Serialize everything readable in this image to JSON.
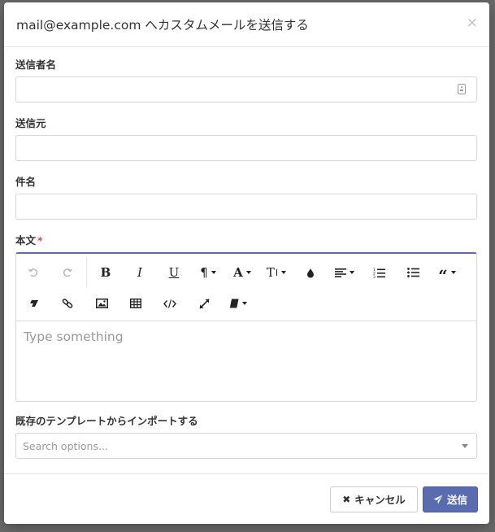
{
  "modal": {
    "title": "mail@example.com へカスタムメールを送信する",
    "close_glyph": "×"
  },
  "form": {
    "sender_name": {
      "label": "送信者名",
      "value": "",
      "icon": "contact-card-icon"
    },
    "sender_from": {
      "label": "送信元",
      "value": ""
    },
    "subject": {
      "label": "件名",
      "value": ""
    },
    "body": {
      "label": "本文",
      "required_mark": "*",
      "placeholder": "Type something",
      "toolbar_row1": [
        "undo-icon",
        "redo-icon",
        "bold-icon",
        "italic-icon",
        "underline-icon",
        "paragraph-icon",
        "font-color-icon",
        "text-size-icon",
        "fill-color-icon",
        "align-icon",
        "ordered-list-icon",
        "unordered-list-icon",
        "blockquote-icon"
      ],
      "toolbar_row2": [
        "eraser-icon",
        "link-icon",
        "image-icon",
        "table-icon",
        "code-view-icon",
        "fullscreen-icon",
        "template-book-icon"
      ]
    },
    "template": {
      "label": "既存のテンプレートからインポートする",
      "placeholder": "Search options..."
    }
  },
  "footer": {
    "cancel_label": "キャンセル",
    "send_label": "送信"
  },
  "colors": {
    "primary": "#5a6bb0",
    "required": "#e04b3c",
    "backdrop": "#6b6b6b"
  }
}
